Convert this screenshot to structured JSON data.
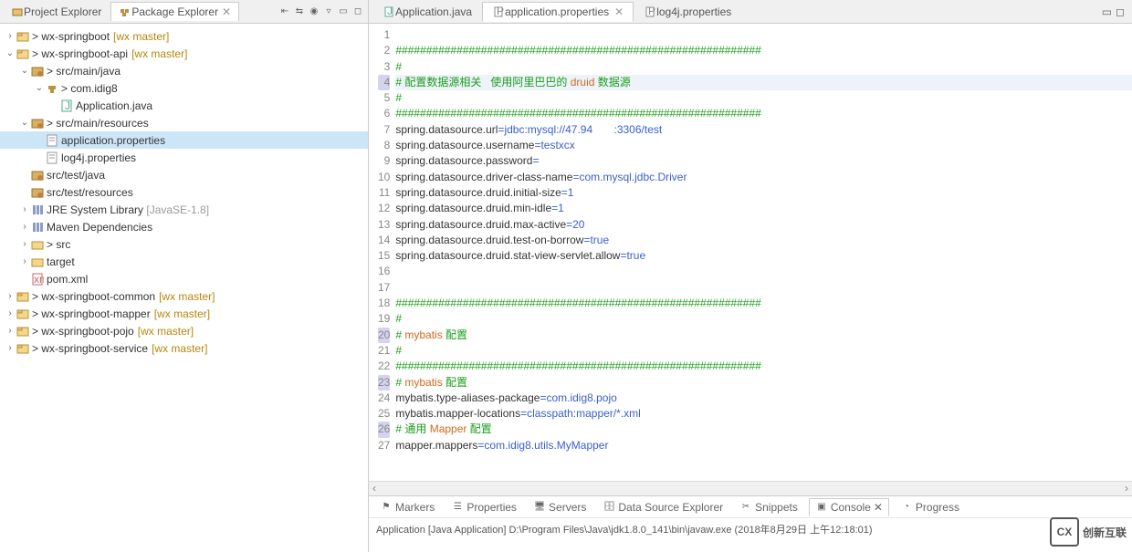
{
  "left_tabs": {
    "project_explorer": "Project Explorer",
    "package_explorer": "Package Explorer"
  },
  "tree": {
    "p0": "wx-springboot",
    "p0_branch": "[wx master]",
    "p1": "wx-springboot-api",
    "p1_branch": "[wx master]",
    "p1_src_main_java": "src/main/java",
    "p1_pkg": "com.idig8",
    "p1_app_java": "Application.java",
    "p1_src_main_res": "src/main/resources",
    "p1_app_props": "application.properties",
    "p1_log4j": "log4j.properties",
    "p1_src_test_java": "src/test/java",
    "p1_src_test_res": "src/test/resources",
    "p1_jre": "JRE System Library",
    "p1_jre_ver": "[JavaSE-1.8]",
    "p1_maven": "Maven Dependencies",
    "p1_src": "src",
    "p1_target": "target",
    "p1_pom": "pom.xml",
    "p2": "wx-springboot-common",
    "p2_branch": "[wx master]",
    "p3": "wx-springboot-mapper",
    "p3_branch": "[wx master]",
    "p4": "wx-springboot-pojo",
    "p4_branch": "[wx master]",
    "p5": "wx-springboot-service",
    "p5_branch": "[wx master]"
  },
  "editor_tabs": {
    "t0": "Application.java",
    "t1": "application.properties",
    "t2": "log4j.properties"
  },
  "code_lines": [
    {
      "n": 1,
      "hl": false,
      "segs": []
    },
    {
      "n": 2,
      "hl": false,
      "segs": [
        {
          "c": "c-green",
          "t": "############################################################"
        }
      ]
    },
    {
      "n": 3,
      "hl": false,
      "segs": [
        {
          "c": "c-green",
          "t": "#"
        }
      ]
    },
    {
      "n": 4,
      "hl": true,
      "cur": true,
      "segs": [
        {
          "c": "c-green",
          "t": "# 配置数据源相关   使用阿里巴巴的 "
        },
        {
          "c": "c-orange",
          "t": "druid"
        },
        {
          "c": "c-green",
          "t": " 数据源"
        }
      ]
    },
    {
      "n": 5,
      "hl": false,
      "segs": [
        {
          "c": "c-green",
          "t": "#"
        }
      ]
    },
    {
      "n": 6,
      "hl": false,
      "segs": [
        {
          "c": "c-green",
          "t": "############################################################"
        }
      ]
    },
    {
      "n": 7,
      "hl": false,
      "segs": [
        {
          "c": "c-black",
          "t": "spring.datasource.url"
        },
        {
          "c": "c-blue",
          "t": "="
        },
        {
          "c": "c-blue",
          "t": "jdbc:mysql://47.94       :3306/test"
        }
      ]
    },
    {
      "n": 8,
      "hl": false,
      "segs": [
        {
          "c": "c-black",
          "t": "spring.datasource.username"
        },
        {
          "c": "c-blue",
          "t": "=testxcx"
        }
      ]
    },
    {
      "n": 9,
      "hl": false,
      "segs": [
        {
          "c": "c-black",
          "t": "spring.datasource.password"
        },
        {
          "c": "c-blue",
          "t": "="
        }
      ]
    },
    {
      "n": 10,
      "hl": false,
      "segs": [
        {
          "c": "c-black",
          "t": "spring.datasource.driver-class-name"
        },
        {
          "c": "c-blue",
          "t": "=com.mysql.jdbc.Driver"
        }
      ]
    },
    {
      "n": 11,
      "hl": false,
      "segs": [
        {
          "c": "c-black",
          "t": "spring.datasource.druid.initial-size"
        },
        {
          "c": "c-blue",
          "t": "=1"
        }
      ]
    },
    {
      "n": 12,
      "hl": false,
      "segs": [
        {
          "c": "c-black",
          "t": "spring.datasource.druid.min-idle"
        },
        {
          "c": "c-blue",
          "t": "=1"
        }
      ]
    },
    {
      "n": 13,
      "hl": false,
      "segs": [
        {
          "c": "c-black",
          "t": "spring.datasource.druid.max-active"
        },
        {
          "c": "c-blue",
          "t": "=20"
        }
      ]
    },
    {
      "n": 14,
      "hl": false,
      "segs": [
        {
          "c": "c-black",
          "t": "spring.datasource.druid.test-on-borrow"
        },
        {
          "c": "c-blue",
          "t": "=true"
        }
      ]
    },
    {
      "n": 15,
      "hl": false,
      "segs": [
        {
          "c": "c-black",
          "t": "spring.datasource.druid.stat-view-servlet.allow"
        },
        {
          "c": "c-blue",
          "t": "=true"
        }
      ]
    },
    {
      "n": 16,
      "hl": false,
      "segs": []
    },
    {
      "n": 17,
      "hl": false,
      "segs": []
    },
    {
      "n": 18,
      "hl": false,
      "segs": [
        {
          "c": "c-green",
          "t": "############################################################"
        }
      ]
    },
    {
      "n": 19,
      "hl": false,
      "segs": [
        {
          "c": "c-green",
          "t": "#"
        }
      ]
    },
    {
      "n": 20,
      "hl": true,
      "segs": [
        {
          "c": "c-green",
          "t": "# "
        },
        {
          "c": "c-orange",
          "t": "mybatis"
        },
        {
          "c": "c-green",
          "t": " 配置"
        }
      ]
    },
    {
      "n": 21,
      "hl": false,
      "segs": [
        {
          "c": "c-green",
          "t": "#"
        }
      ]
    },
    {
      "n": 22,
      "hl": false,
      "segs": [
        {
          "c": "c-green",
          "t": "############################################################"
        }
      ]
    },
    {
      "n": 23,
      "hl": true,
      "segs": [
        {
          "c": "c-green",
          "t": "# "
        },
        {
          "c": "c-orange",
          "t": "mybatis"
        },
        {
          "c": "c-green",
          "t": " 配置"
        }
      ]
    },
    {
      "n": 24,
      "hl": false,
      "segs": [
        {
          "c": "c-black",
          "t": "mybatis.type-aliases-package"
        },
        {
          "c": "c-blue",
          "t": "=com.idig8.pojo"
        }
      ]
    },
    {
      "n": 25,
      "hl": false,
      "segs": [
        {
          "c": "c-black",
          "t": "mybatis.mapper-locations"
        },
        {
          "c": "c-blue",
          "t": "=classpath:mapper/*.xml"
        }
      ]
    },
    {
      "n": 26,
      "hl": true,
      "segs": [
        {
          "c": "c-green",
          "t": "# 通用 "
        },
        {
          "c": "c-orange",
          "t": "Mapper"
        },
        {
          "c": "c-green",
          "t": " 配置"
        }
      ]
    },
    {
      "n": 27,
      "hl": false,
      "segs": [
        {
          "c": "c-black",
          "t": "mapper.mappers"
        },
        {
          "c": "c-blue",
          "t": "=com.idig8.utils.MyMapper"
        }
      ]
    }
  ],
  "bottom_tabs": {
    "markers": "Markers",
    "properties": "Properties",
    "servers": "Servers",
    "dse": "Data Source Explorer",
    "snippets": "Snippets",
    "console": "Console",
    "progress": "Progress"
  },
  "console_text": "Application [Java Application] D:\\Program Files\\Java\\jdk1.8.0_141\\bin\\javaw.exe (2018年8月29日 上午12:18:01)",
  "watermark": "创新互联"
}
